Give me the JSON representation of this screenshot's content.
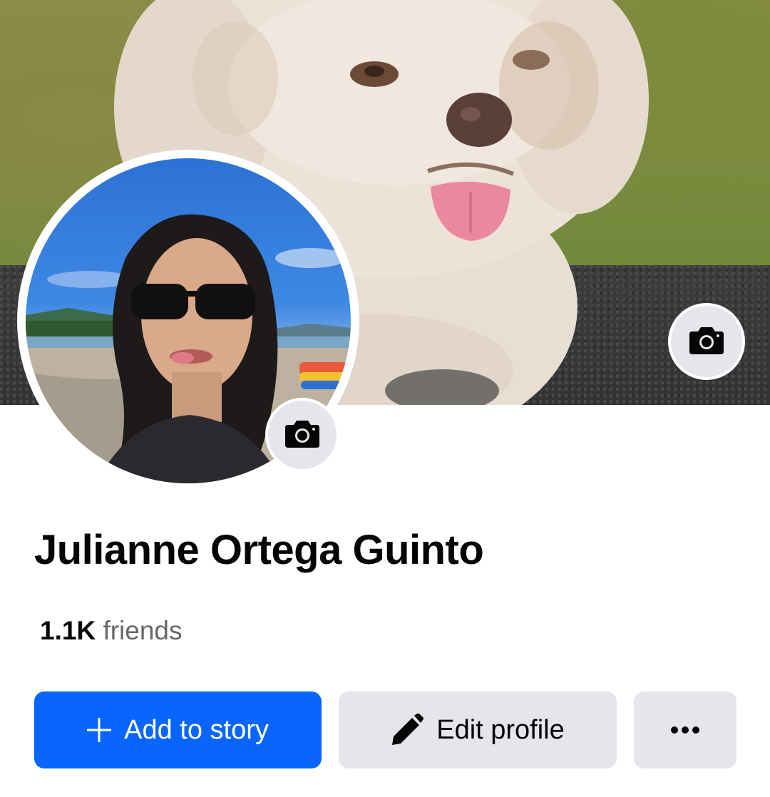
{
  "profile": {
    "name": "Julianne Ortega Guinto",
    "friends_count": "1.1K",
    "friends_label": "friends"
  },
  "actions": {
    "add_story_label": "Add to story",
    "edit_profile_label": "Edit profile"
  },
  "icons": {
    "cover_camera": "camera-icon",
    "avatar_camera": "camera-icon",
    "add_story": "plus-icon",
    "edit_profile": "pencil-icon",
    "more": "more-dots-icon"
  },
  "colors": {
    "primary_blue": "#0866ff",
    "secondary_gray": "#e4e6eb",
    "text_primary": "#050505",
    "text_secondary": "#65676b"
  }
}
